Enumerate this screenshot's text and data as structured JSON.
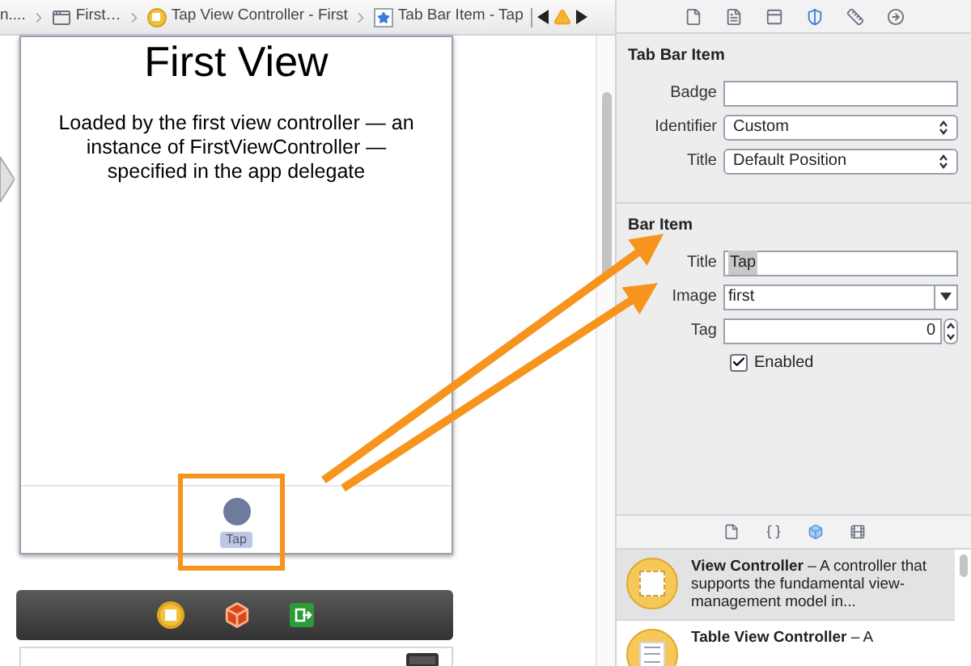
{
  "breadcrumb": [
    {
      "kind": "plain",
      "label": "n...."
    },
    {
      "kind": "window",
      "label": "First…"
    },
    {
      "kind": "controller",
      "label": "Tap View Controller - First"
    },
    {
      "kind": "star",
      "label": "Tab Bar Item - Tap"
    }
  ],
  "canvas": {
    "title": "First View",
    "description": "Loaded by the first view controller — an instance of FirstViewController — specified in the app delegate",
    "tab_item": {
      "label": "Tap"
    }
  },
  "inspector": {
    "sections": [
      {
        "title": "Tab Bar Item",
        "fields": [
          {
            "kind": "text",
            "label": "Badge"
          },
          {
            "kind": "select",
            "label": "Identifier",
            "value": "Custom"
          },
          {
            "kind": "select",
            "label": "Title",
            "value": "Default Position"
          }
        ]
      },
      {
        "title": "Bar Item",
        "fields": [
          {
            "kind": "text",
            "label": "Title",
            "value": "Tap",
            "highlighted": true
          },
          {
            "kind": "combo",
            "label": "Image",
            "value": "first"
          },
          {
            "kind": "stepper",
            "label": "Tag",
            "value": "0"
          },
          {
            "kind": "checkbox",
            "label": "Enabled",
            "checked": true
          }
        ]
      }
    ]
  },
  "library": {
    "items": [
      {
        "kind": "view",
        "text": "**View Controller** – A controller that supports the fundamental view-management model in...",
        "selected": true
      },
      {
        "kind": "table",
        "text": "**Table View Controller** – A",
        "selected": false
      }
    ]
  }
}
